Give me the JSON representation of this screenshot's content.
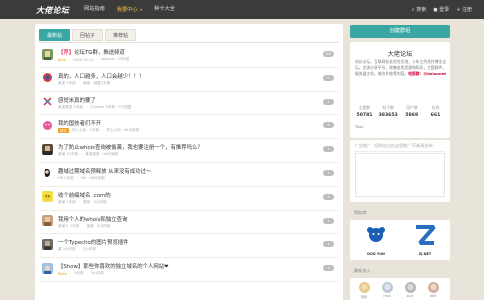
{
  "header": {
    "logo": "大佬论坛",
    "nav": [
      {
        "label": "网站指南",
        "active": false
      },
      {
        "label": "我要中心",
        "active": true
      },
      {
        "label": "种卡大全",
        "active": false
      }
    ],
    "caret": "▾",
    "search": "搜索",
    "login": "登录",
    "register": "注册"
  },
  "tabs": [
    "最新帖",
    "回帖子",
    "推荐帖"
  ],
  "posts": [
    {
      "title_tag": "【荐】",
      "title": "论坛TG群，推送频道",
      "author": "fans",
      "time": "2020-10-21",
      "extra": "xgdyoo · 25天前",
      "count": "10",
      "badge": ""
    },
    {
      "title_tag": "",
      "title": "真的，人口越多，人口会越少！！！",
      "author": "",
      "time": "某某 2天前",
      "extra": "阅读 · 回复1天前",
      "count": "0",
      "badge": ""
    },
    {
      "title_tag": "",
      "title": "感觉米真的要了",
      "author": "",
      "time": "某某某某 1天前",
      "extra": "2Tdown 5天前 · 3个回复",
      "count": "1",
      "badge": ""
    },
    {
      "title_tag": "",
      "title": "我的国技者们不开",
      "author": "",
      "time": "开心上仙 · 1天前",
      "extra": "开心上仙 · 44分钟前",
      "count": "5",
      "badge": "精华"
    },
    {
      "title_tag": "",
      "title": "为了防止whois查询被偷袭，我也要注册一个，有推荐吗么？",
      "author": "",
      "time": "某某 12天前",
      "extra": "某某某某 · 46分钟前",
      "count": "1",
      "badge": ""
    },
    {
      "title_tag": "",
      "title": "趣域过期域名预释放 从来没有成功过～",
      "author": "",
      "time": "HK 2天前",
      "extra": "HK · 48分钟前",
      "count": "1",
      "badge": ""
    },
    {
      "title_tag": "",
      "title": "收个前缀域名 .com的",
      "author": "",
      "time": "某某 1天前",
      "extra": "某某 · 3小时前",
      "count": "3",
      "badge": ""
    },
    {
      "title_tag": "",
      "title": "我用个人的whois和独立查询",
      "author": "",
      "time": "某某人 2天前",
      "extra": "某某 · 3小时前",
      "count": "1",
      "badge": ""
    },
    {
      "title_tag": "",
      "title": "一个Typecho的图片预览插件",
      "author": "",
      "time": "某 2小时前",
      "extra": "2小时前",
      "count": "1",
      "badge": ""
    },
    {
      "title_tag": "",
      "title": "【Show】那些你喜欢的独立域名的个人网站❤",
      "author": "Ryan",
      "time": "3天前",
      "extra": "2小时前",
      "count": "2",
      "badge": ""
    }
  ],
  "sidebar": {
    "create_button": "创建群组",
    "info_title": "大佬论坛",
    "info_text": "站长论坛，互联网站长综合交流，十年之约合作博主论坛，交流分享平台，收集各类资源和知识，主题群件，服务器主机，域名外链等内容。",
    "info_highlight": "电报群：@dalaonet",
    "stats": [
      {
        "label": "主题数",
        "value": "50781"
      },
      {
        "label": "帖子数",
        "value": "383653"
      },
      {
        "label": "用户数",
        "value": "5869"
      },
      {
        "label": "在线",
        "value": "661"
      }
    ],
    "tips": "Tips：",
    "ad_title": "广告推广（您的站点在这里推广TG新版发布）",
    "ad_title_prefix": "广告推广",
    "sponsors_title": "赞助商",
    "sponsors": [
      {
        "label": "DOG YUN",
        "color": "#1a5fb4"
      },
      {
        "label": "ZJ.NET",
        "color": "#2a6fbf"
      }
    ],
    "members_title": "最新加入",
    "members": [
      {
        "name": "玩玩"
      },
      {
        "name": "rhuh"
      },
      {
        "name": "slurl"
      },
      {
        "name": "dkft"
      }
    ]
  },
  "colors": {
    "accent": "#3aa7a3",
    "topbar": "#3b3b3b",
    "background": "#e9e4d9",
    "hot": "#cc0033"
  }
}
